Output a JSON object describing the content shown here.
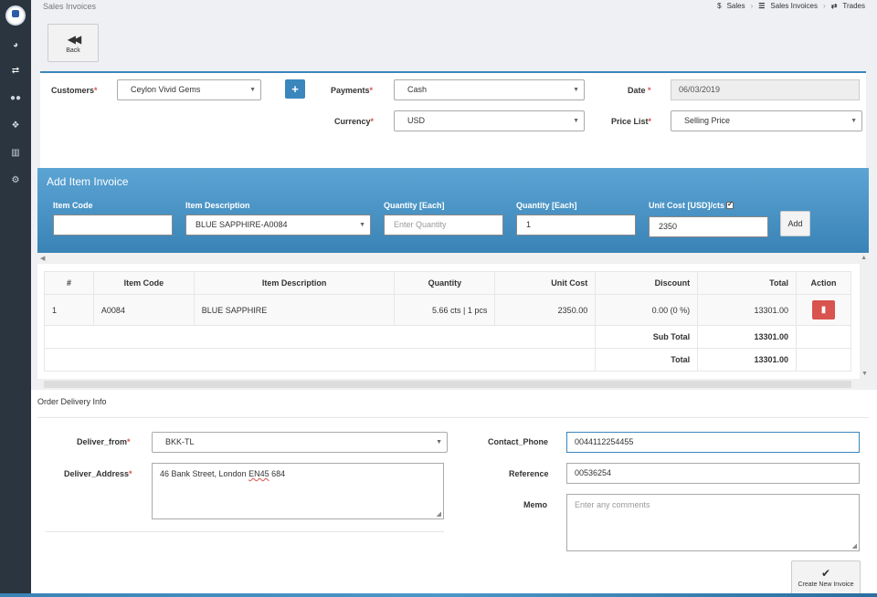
{
  "sidebar": {
    "icons": [
      "logo",
      "dashboard-icon",
      "trades-icon",
      "users-icon",
      "cubes-icon",
      "chart-icon",
      "settings-icon"
    ]
  },
  "header": {
    "page_name": "Sales Invoices",
    "breadcrumbs": [
      {
        "icon": "$",
        "label": "Sales"
      },
      {
        "icon": "☰",
        "label": "Sales Invoices"
      },
      {
        "icon": "⇄",
        "label": "Trades"
      }
    ],
    "back_label": "Back"
  },
  "form": {
    "customers_label": "Customers",
    "customers_value": "Ceylon Vivid Gems",
    "payments_label": "Payments",
    "payments_value": "Cash",
    "date_label": "Date",
    "date_value": "06/03/2019",
    "currency_label": "Currency",
    "currency_value": "USD",
    "price_list_label": "Price List",
    "price_list_value": "Selling Price",
    "required_mark": "*"
  },
  "add_item": {
    "title": "Add Item Invoice",
    "item_code_label": "Item Code",
    "item_code_value": "",
    "item_description_label": "Item Description",
    "item_description_value": "BLUE SAPPHIRE-A0084",
    "quantity_each_label": "Quantity [Each]",
    "quantity_placeholder": "Enter Quantity",
    "quantity2_label": "Quantity [Each]",
    "quantity2_value": "1",
    "unit_cost_label": "Unit Cost [USD]/cts",
    "unit_cost_checked": true,
    "unit_cost_value": "2350",
    "add_button": "Add"
  },
  "table": {
    "headers": [
      "#",
      "Item Code",
      "Item Description",
      "Quantity",
      "Unit Cost",
      "Discount",
      "Total",
      "Action"
    ],
    "rows": [
      {
        "no": "1",
        "code": "A0084",
        "description": "BLUE SAPPHIRE",
        "quantity": "5.66 cts | 1 pcs",
        "unit_cost": "2350.00",
        "discount": "0.00 (0 %)",
        "total": "13301.00"
      }
    ],
    "sub_total_label": "Sub Total",
    "sub_total_value": "13301.00",
    "total_label": "Total",
    "total_value": "13301.00"
  },
  "delivery": {
    "section_title": "Order Delivery Info",
    "deliver_from_label": "Deliver_from",
    "deliver_from_value": "BKK-TL",
    "deliver_address_label": "Deliver_Address",
    "deliver_address_value_a": "46 Bank Street, London ",
    "deliver_address_value_b": "EN45",
    "deliver_address_value_c": " 684",
    "contact_phone_label": "Contact_Phone",
    "contact_phone_value": "0044112254455",
    "reference_label": "Reference",
    "reference_value": "00536254",
    "memo_label": "Memo",
    "memo_placeholder": "Enter any comments",
    "create_button": "Create New Invoice"
  },
  "colors": {
    "sidebar": "#2a3540",
    "accent": "#3a86bd",
    "panel": "#4b97c8",
    "danger": "#d9534f"
  }
}
